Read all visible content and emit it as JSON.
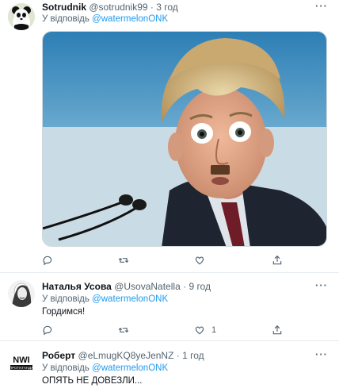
{
  "tweets": [
    {
      "name": "Sotrudnik",
      "handle": "@sotrudnik99",
      "dot": "·",
      "time": "3 год",
      "reply_prefix": "У відповідь",
      "reply_to": "@watermelonONK",
      "text": "",
      "reply_count": "",
      "retweet_count": "",
      "like_count": "",
      "avatar_icon": "panda-avatar-icon"
    },
    {
      "name": "Наталья Усова",
      "handle": "@UsovaNatella",
      "dot": "·",
      "time": "9 год",
      "reply_prefix": "У відповідь",
      "reply_to": "@watermelonONK",
      "text": "Гордимся!",
      "reply_count": "",
      "retweet_count": "",
      "like_count": "1",
      "avatar_icon": "bw-portrait-avatar-icon"
    },
    {
      "name": "Роберт",
      "handle": "@eLmugKQ8yeJenNZ",
      "dot": "·",
      "time": "1 год",
      "reply_prefix": "У відповідь",
      "reply_to": "@watermelonONK",
      "text": "ОПЯТЬ НЕ ДОВЕЗЛИ...",
      "avatar_icon": "nwi-propaganda-logo-icon"
    }
  ],
  "colors": {
    "link": "#1d9bf0",
    "secondary": "#536471",
    "border": "#e6ecf0"
  }
}
